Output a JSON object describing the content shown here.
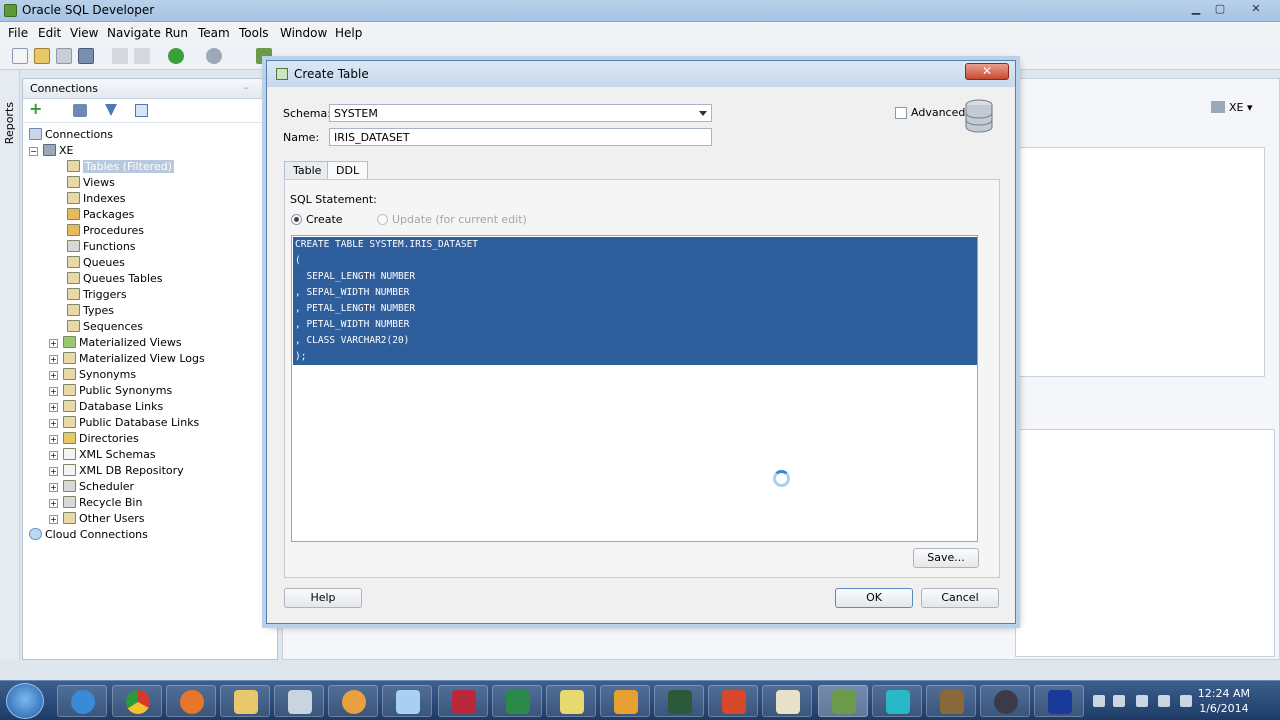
{
  "window": {
    "title": "Oracle SQL Developer",
    "controls": {
      "minimize": "▁",
      "maximize": "▢",
      "close": "✕"
    }
  },
  "menu": [
    "File",
    "Edit",
    "View",
    "Navigate",
    "Run",
    "Team",
    "Tools",
    "Window",
    "Help"
  ],
  "sidebar_strip": {
    "label": "Reports"
  },
  "connections_panel": {
    "title": "Connections",
    "minimize_glyph": "–",
    "tree": [
      {
        "label": "Connections"
      },
      {
        "label": "XE"
      },
      {
        "label": "Tables (Filtered)"
      },
      {
        "label": "Views"
      },
      {
        "label": "Indexes"
      },
      {
        "label": "Packages"
      },
      {
        "label": "Procedures"
      },
      {
        "label": "Functions"
      },
      {
        "label": "Queues"
      },
      {
        "label": "Queues Tables"
      },
      {
        "label": "Triggers"
      },
      {
        "label": "Types"
      },
      {
        "label": "Sequences"
      },
      {
        "label": "Materialized Views"
      },
      {
        "label": "Materialized View Logs"
      },
      {
        "label": "Synonyms"
      },
      {
        "label": "Public Synonyms"
      },
      {
        "label": "Database Links"
      },
      {
        "label": "Public Database Links"
      },
      {
        "label": "Directories"
      },
      {
        "label": "XML Schemas"
      },
      {
        "label": "XML DB Repository"
      },
      {
        "label": "Scheduler"
      },
      {
        "label": "Recycle Bin"
      },
      {
        "label": "Other Users"
      },
      {
        "label": "Cloud Connections"
      }
    ],
    "expander_plus": "+",
    "expander_minus": "−"
  },
  "right_panel": {
    "connection_dropdown": "XE"
  },
  "dialog": {
    "title": "Create Table",
    "close_glyph": "✕",
    "schema_label": "Schema:",
    "schema_value": "SYSTEM",
    "name_label": "Name:",
    "name_value": "IRIS_DATASET",
    "advanced_label": "Advanced",
    "tabs": [
      "Table",
      "DDL"
    ],
    "sql_statement_label": "SQL Statement:",
    "radio_create": "Create",
    "radio_update": "Update (for current edit)",
    "sql_lines": [
      "CREATE TABLE SYSTEM.IRIS_DATASET",
      "(",
      "  SEPAL_LENGTH NUMBER",
      ", SEPAL_WIDTH NUMBER",
      ", PETAL_LENGTH NUMBER",
      ", PETAL_WIDTH NUMBER",
      ", CLASS VARCHAR2(20)",
      ");"
    ],
    "save_button": "Save...",
    "help_button": "Help",
    "ok_button": "OK",
    "cancel_button": "Cancel"
  },
  "taskbar": {
    "clock_time": "12:24 AM",
    "clock_date": "1/6/2014"
  },
  "colors": {
    "selection_blue": "#2f5e9d",
    "title_bar": "#b9d1ea",
    "taskbar": "#1d3b66"
  }
}
